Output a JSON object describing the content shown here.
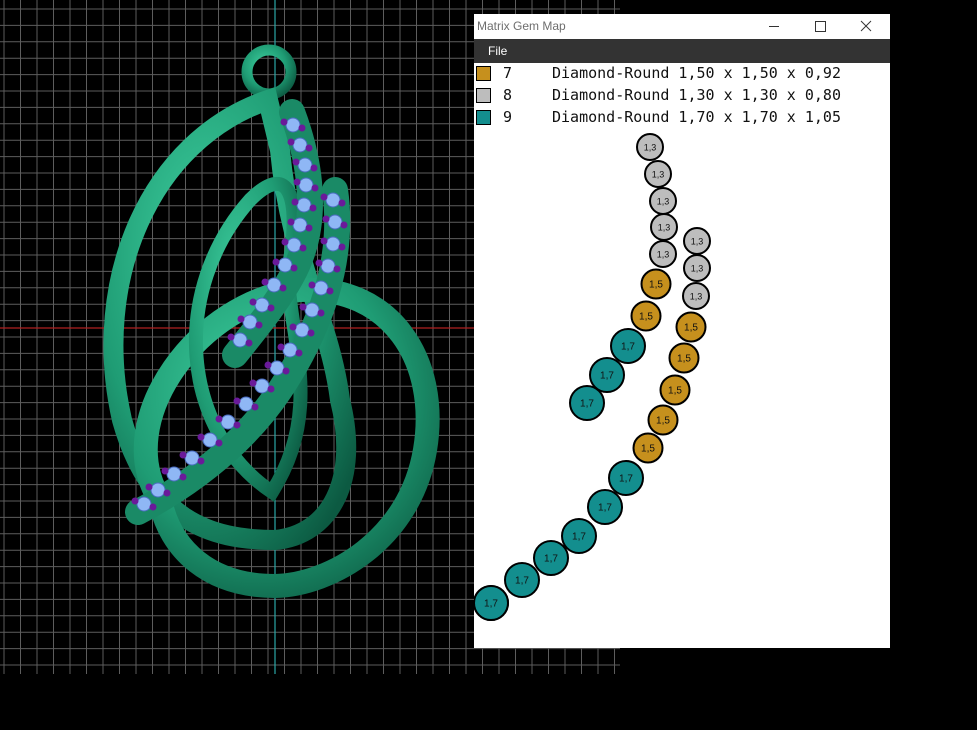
{
  "window": {
    "title": "Matrix Gem Map",
    "controls": [
      "minimize",
      "maximize",
      "close"
    ],
    "menu": [
      "File"
    ]
  },
  "legend": [
    {
      "id": "7",
      "desc": "Diamond-Round 1,50 x 1,50 x 0,92",
      "color": "#c6901d"
    },
    {
      "id": "8",
      "desc": "Diamond-Round 1,30 x 1,30 x 0,80",
      "color": "#bdbdbd"
    },
    {
      "id": "9",
      "desc": "Diamond-Round 1,70 x 1,70 x 1,05",
      "color": "#138e8e"
    }
  ],
  "gem_labels": {
    "7": "1,5",
    "8": "1,3",
    "9": "1,7"
  },
  "gem_chains": [
    [
      "8",
      "8",
      "8",
      "8",
      "8",
      "7",
      "7",
      "9",
      "9",
      "9"
    ],
    [
      "8",
      "8",
      "8",
      "7",
      "7",
      "7",
      "7",
      "7",
      "9",
      "9",
      "9",
      "9",
      "9",
      "9",
      "9"
    ]
  ],
  "viewport": {
    "background": "#000000",
    "grid_color": "#6a6a6a",
    "model_color": "#1f9c74",
    "gem_color": "#8fb7f5",
    "prong_color": "#6a1a9a"
  }
}
